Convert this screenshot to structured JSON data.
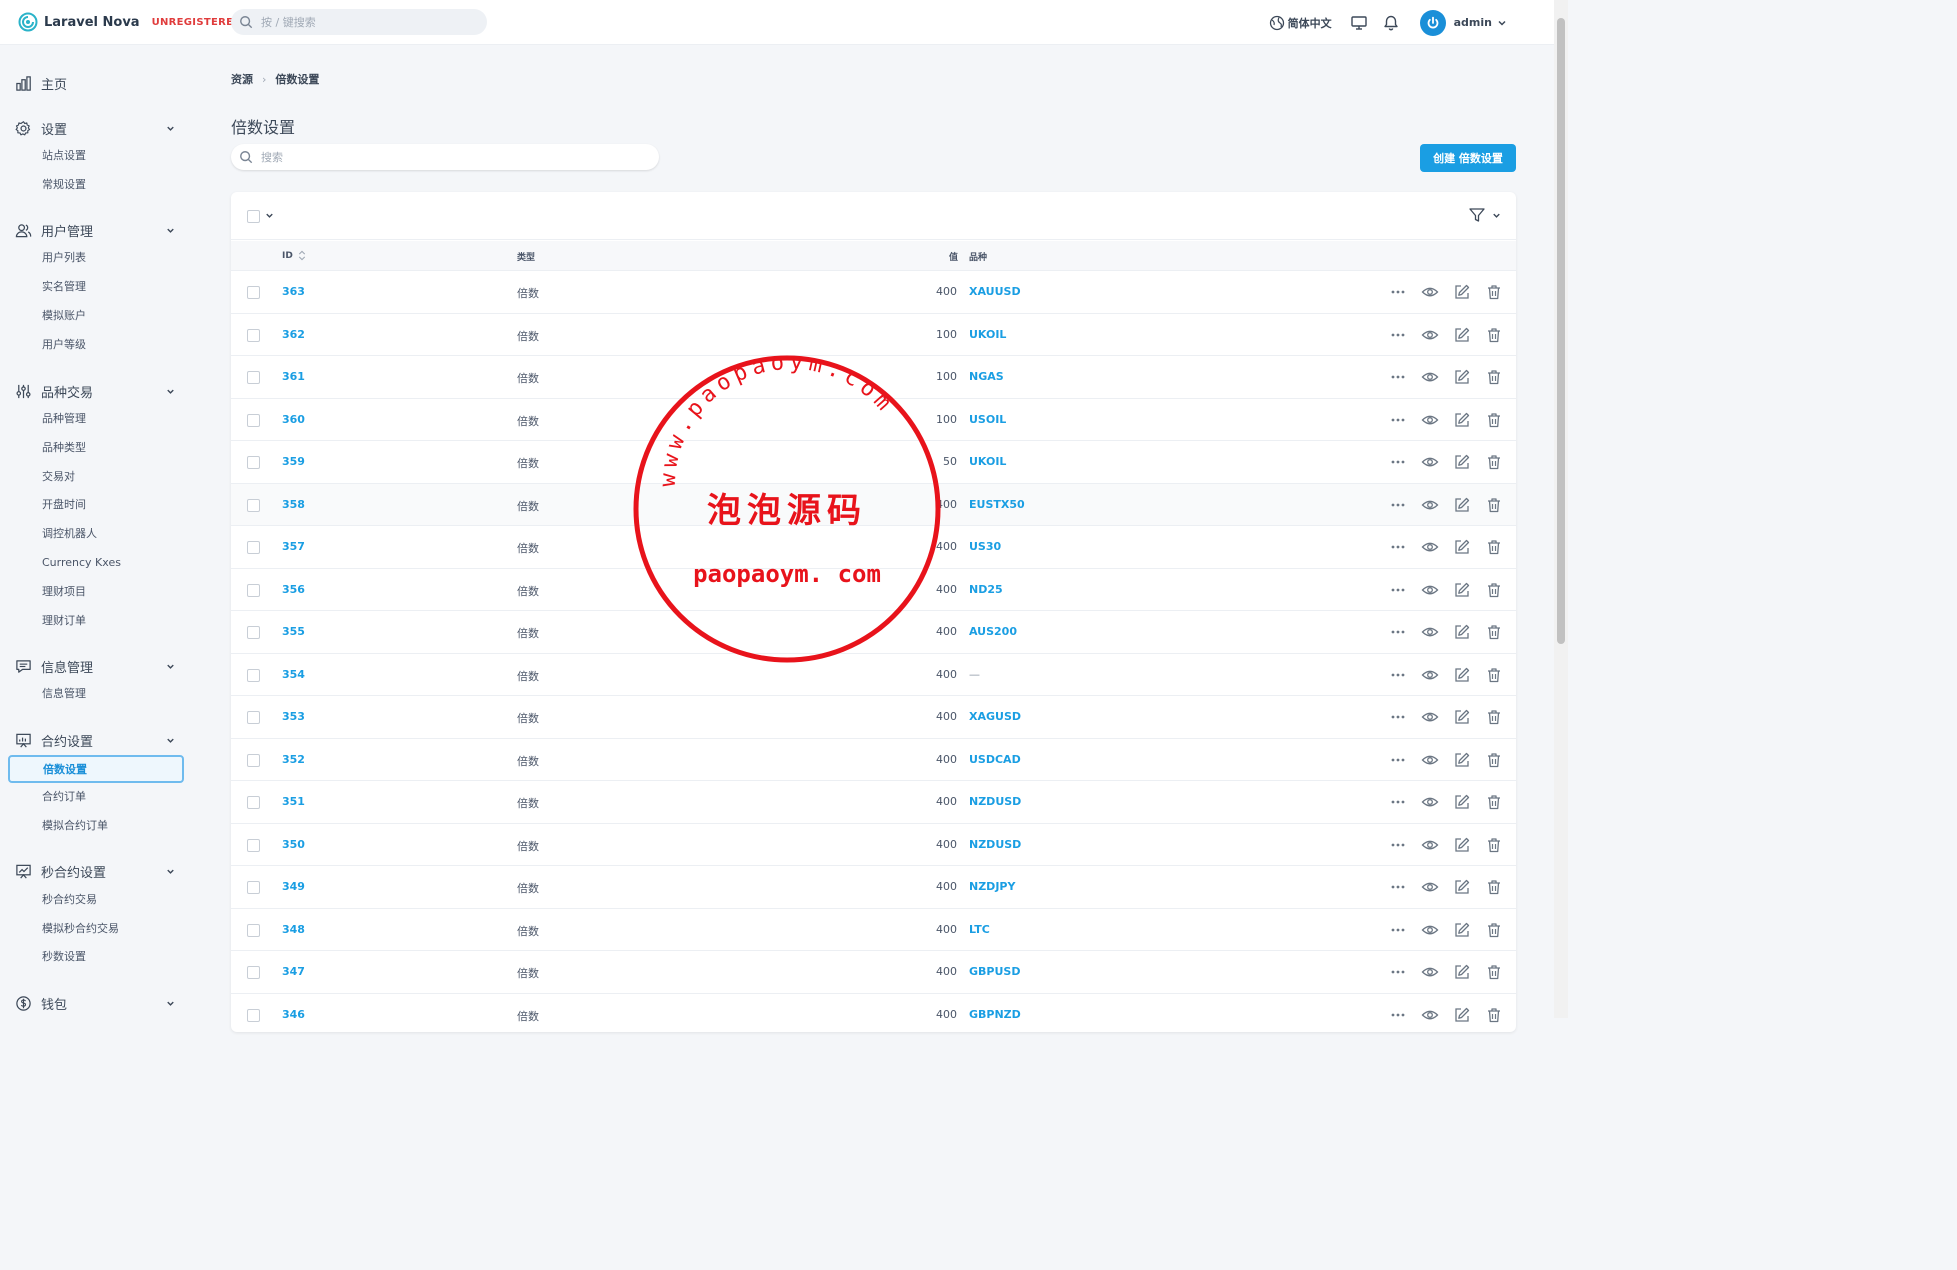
{
  "app": {
    "name": "Laravel Nova",
    "badge": "UNREGISTERED"
  },
  "header": {
    "search_placeholder": "按 / 键搜索",
    "language": "简体中文",
    "user": "admin"
  },
  "sidebar": {
    "groups": [
      {
        "label": "主页",
        "icon": "chart-bar-icon",
        "items": []
      },
      {
        "label": "设置",
        "icon": "gear-icon",
        "items": [
          "站点设置",
          "常规设置"
        ]
      },
      {
        "label": "用户管理",
        "icon": "users-icon",
        "items": [
          "用户列表",
          "实名管理",
          "模拟账户",
          "用户等级"
        ]
      },
      {
        "label": "品种交易",
        "icon": "adjustments-icon",
        "items": [
          "品种管理",
          "品种类型",
          "交易对",
          "开盘时间",
          "调控机器人",
          "Currency Kxes",
          "理财项目",
          "理财订单"
        ]
      },
      {
        "label": "信息管理",
        "icon": "chat-icon",
        "items": [
          "信息管理"
        ]
      },
      {
        "label": "合约设置",
        "icon": "presentation-icon",
        "items": [
          "倍数设置",
          "合约订单",
          "模拟合约订单"
        ]
      },
      {
        "label": "秒合约设置",
        "icon": "presentation-chart-icon",
        "items": [
          "秒合约交易",
          "模拟秒合约交易",
          "秒数设置"
        ]
      },
      {
        "label": "钱包",
        "icon": "currency-icon",
        "items": []
      }
    ],
    "active_item": "倍数设置"
  },
  "breadcrumb": [
    "资源",
    "倍数设置"
  ],
  "page": {
    "title": "倍数设置",
    "search_placeholder": "搜索",
    "create_label": "创建 倍数设置"
  },
  "table": {
    "columns": {
      "id": "ID",
      "type": "类型",
      "value": "值",
      "symbol": "品种"
    },
    "rows": [
      {
        "id": "363",
        "type": "倍数",
        "value": "400",
        "symbol": "XAUUSD"
      },
      {
        "id": "362",
        "type": "倍数",
        "value": "100",
        "symbol": "UKOIL"
      },
      {
        "id": "361",
        "type": "倍数",
        "value": "100",
        "symbol": "NGAS"
      },
      {
        "id": "360",
        "type": "倍数",
        "value": "100",
        "symbol": "USOIL"
      },
      {
        "id": "359",
        "type": "倍数",
        "value": "50",
        "symbol": "UKOIL"
      },
      {
        "id": "358",
        "type": "倍数",
        "value": "400",
        "symbol": "EUSTX50"
      },
      {
        "id": "357",
        "type": "倍数",
        "value": "400",
        "symbol": "US30"
      },
      {
        "id": "356",
        "type": "倍数",
        "value": "400",
        "symbol": "ND25"
      },
      {
        "id": "355",
        "type": "倍数",
        "value": "400",
        "symbol": "AUS200"
      },
      {
        "id": "354",
        "type": "倍数",
        "value": "400",
        "symbol": "—"
      },
      {
        "id": "353",
        "type": "倍数",
        "value": "400",
        "symbol": "XAGUSD"
      },
      {
        "id": "352",
        "type": "倍数",
        "value": "400",
        "symbol": "USDCAD"
      },
      {
        "id": "351",
        "type": "倍数",
        "value": "400",
        "symbol": "NZDUSD"
      },
      {
        "id": "350",
        "type": "倍数",
        "value": "400",
        "symbol": "NZDUSD"
      },
      {
        "id": "349",
        "type": "倍数",
        "value": "400",
        "symbol": "NZDJPY"
      },
      {
        "id": "348",
        "type": "倍数",
        "value": "400",
        "symbol": "LTC"
      },
      {
        "id": "347",
        "type": "倍数",
        "value": "400",
        "symbol": "GBPUSD"
      },
      {
        "id": "346",
        "type": "倍数",
        "value": "400",
        "symbol": "GBPNZD"
      }
    ],
    "highlighted_row": "358"
  },
  "watermark": {
    "arc_text": "www.paopaoym.com",
    "center_text": "泡泡源码",
    "bottom_text": "paopaoym. com"
  },
  "colors": {
    "accent": "#1a9ee3",
    "brand": "#1a8fd8",
    "badge": "#e03c3c",
    "stamp": "#e8131b"
  }
}
